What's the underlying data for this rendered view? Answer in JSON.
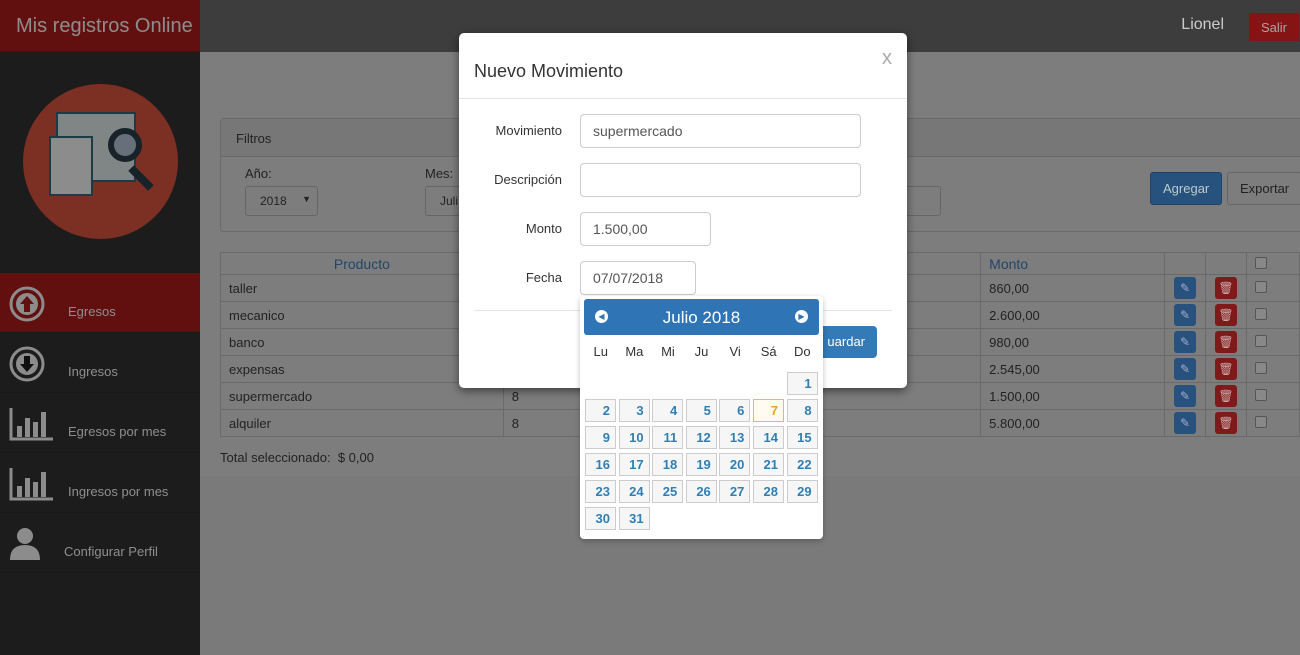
{
  "app": {
    "brand": "Mis registros Online",
    "user": "Lionel",
    "logout": "Salir"
  },
  "colors": {
    "brand_red": "#b31b1b",
    "accent_blue": "#337ab7",
    "today_orange": "#e8a317"
  },
  "sidebar": {
    "items": [
      {
        "label": "Egresos",
        "icon": "arrow-up-circle-icon"
      },
      {
        "label": "Ingresos",
        "icon": "arrow-down-circle-icon"
      },
      {
        "label": "Egresos por mes",
        "icon": "bar-chart-icon"
      },
      {
        "label": "Ingresos por mes",
        "icon": "bar-chart-icon"
      },
      {
        "label": "Configurar Perfil",
        "icon": "user-icon"
      }
    ]
  },
  "filters": {
    "title": "Filtros",
    "year_label": "Año:",
    "year_value": "2018",
    "month_label": "Mes:",
    "month_value": "Juli",
    "add": "Agregar",
    "export": "Exportar"
  },
  "table": {
    "headers": {
      "product": "Producto",
      "amount": "Monto"
    },
    "rows": [
      {
        "product": "taller",
        "mid": "",
        "amount": "860,00"
      },
      {
        "product": "mecanico",
        "mid": "",
        "amount": "2.600,00"
      },
      {
        "product": "banco",
        "mid": "",
        "amount": "980,00"
      },
      {
        "product": "expensas",
        "mid": "",
        "amount": "2.545,00"
      },
      {
        "product": "supermercado",
        "mid": "8",
        "amount": "1.500,00"
      },
      {
        "product": "alquiler",
        "mid": "8",
        "amount": "5.800,00"
      }
    ],
    "total_label": "Total seleccionado:",
    "total_value": "$ 0,00"
  },
  "modal": {
    "title": "Nuevo Movimiento",
    "close": "x",
    "fields": {
      "movimiento": {
        "label": "Movimiento",
        "value": "supermercado"
      },
      "descripcion": {
        "label": "Descripción",
        "value": ""
      },
      "monto": {
        "label": "Monto",
        "value": "1.500,00"
      },
      "fecha": {
        "label": "Fecha",
        "value": "07/07/2018"
      }
    },
    "save": "uardar"
  },
  "datepicker": {
    "title": "Julio 2018",
    "weekdays": [
      "Lu",
      "Ma",
      "Mi",
      "Ju",
      "Vi",
      "Sá",
      "Do"
    ],
    "first_weekday_index": 6,
    "days_in_month": 31,
    "selected_day": 7
  }
}
